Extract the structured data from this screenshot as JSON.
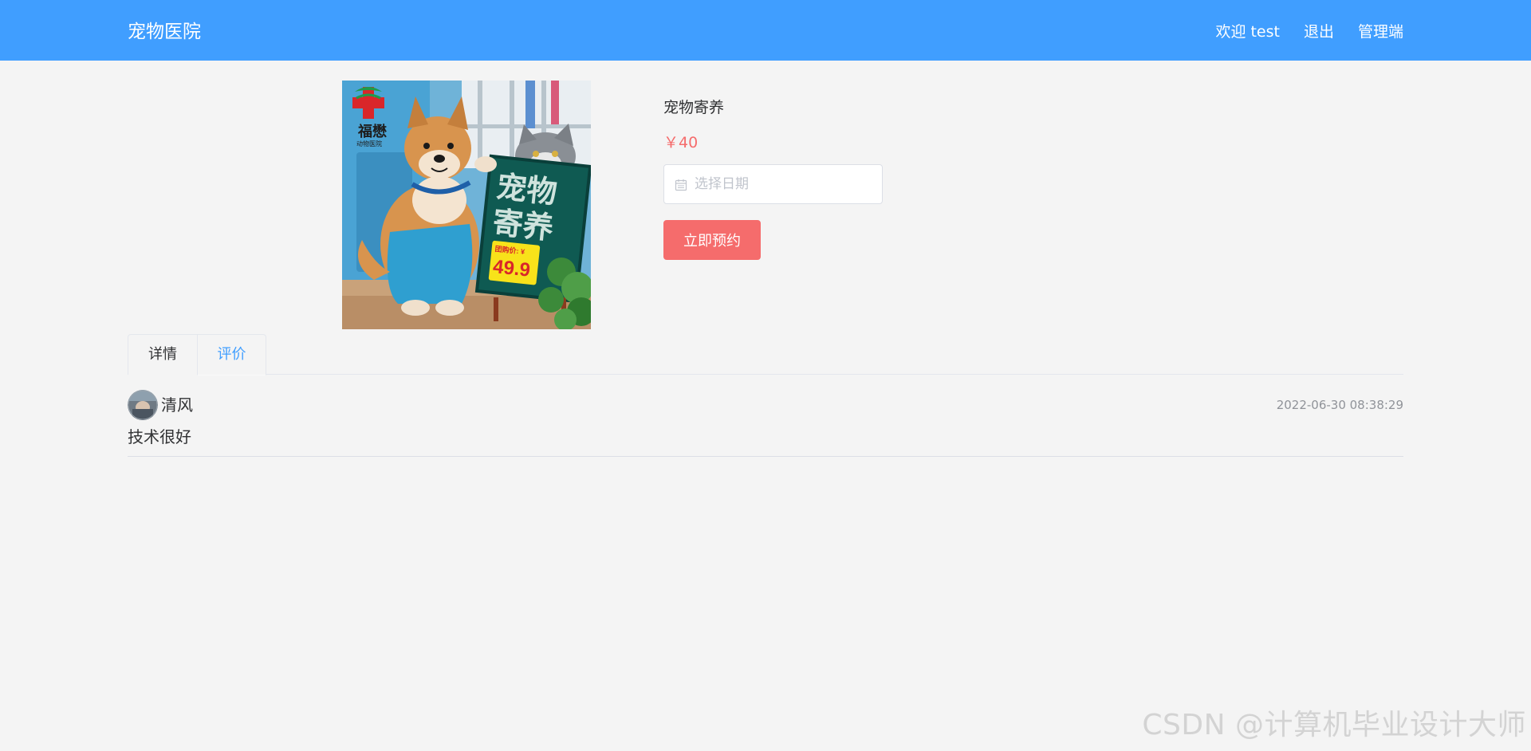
{
  "header": {
    "brand": "宠物医院",
    "nav": {
      "welcome": "欢迎 test",
      "logout": "退出",
      "admin": "管理端"
    }
  },
  "product": {
    "image": {
      "sign_text_1": "宠物",
      "sign_text_2": "寄养",
      "price_tag_label": "团购价: ¥",
      "price_tag_value": "49.9",
      "logo_text": "福懋",
      "logo_subtext": "动物医院"
    },
    "title": "宠物寄养",
    "price": "￥40",
    "date_placeholder": "选择日期",
    "book_label": "立即预约"
  },
  "tabs": [
    {
      "label": "详情",
      "active": false
    },
    {
      "label": "评价",
      "active": true
    }
  ],
  "reviews": [
    {
      "author": "清风",
      "time": "2022-06-30 08:38:29",
      "content": "技术很好"
    }
  ],
  "watermark": "CSDN @计算机毕业设计大师",
  "colors": {
    "header_bg": "#409eff",
    "accent": "#409eff",
    "price": "#f56c6c",
    "button": "#f56c6c",
    "page_bg": "#f4f4f4"
  }
}
